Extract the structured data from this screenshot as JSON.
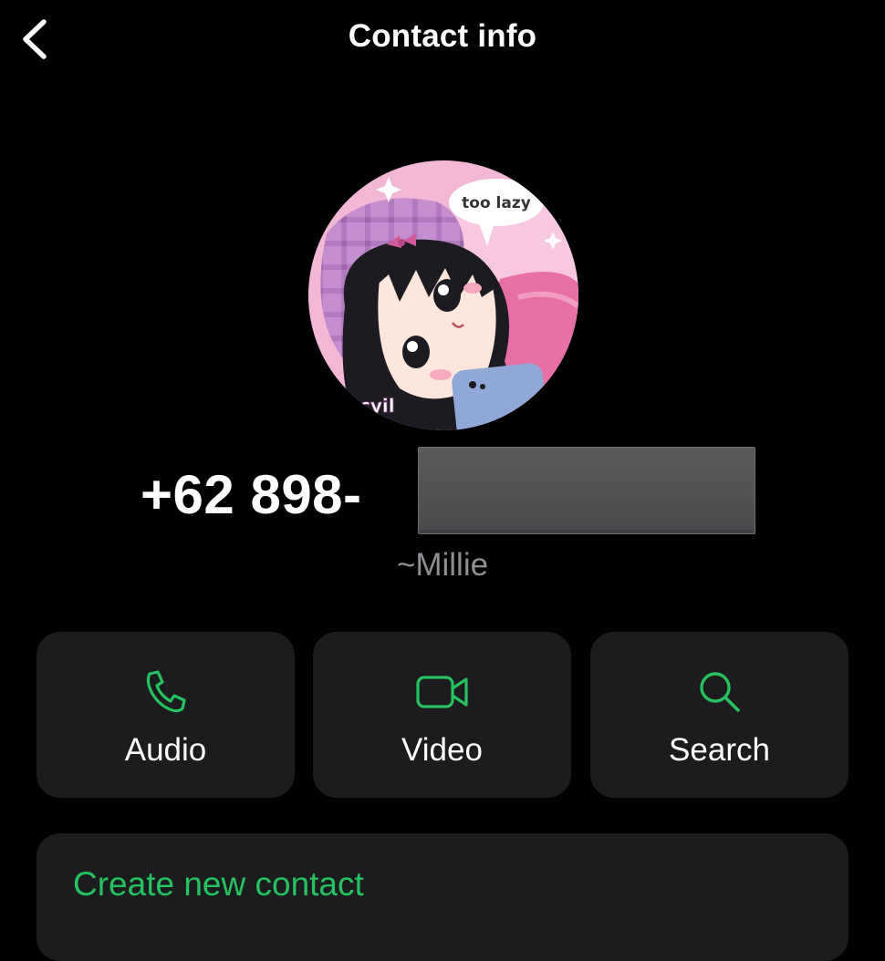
{
  "header": {
    "title": "Contact info",
    "back_icon": "chevron-left-icon"
  },
  "profile": {
    "avatar_bubble_text": "too lazy",
    "avatar_corner_text": "cyil",
    "phone_prefix": "+62 898-",
    "phone_redacted": true,
    "name": "~Millie"
  },
  "actions": [
    {
      "label": "Audio",
      "icon": "phone-icon"
    },
    {
      "label": "Video",
      "icon": "video-camera-icon"
    },
    {
      "label": "Search",
      "icon": "search-icon"
    }
  ],
  "create_contact": {
    "label": "Create new contact"
  },
  "colors": {
    "background": "#000000",
    "card": "#1c1c1e",
    "accent_green": "#25c25f",
    "secondary_text": "#8e8e93",
    "avatar_pink": "#f3b8d6"
  }
}
